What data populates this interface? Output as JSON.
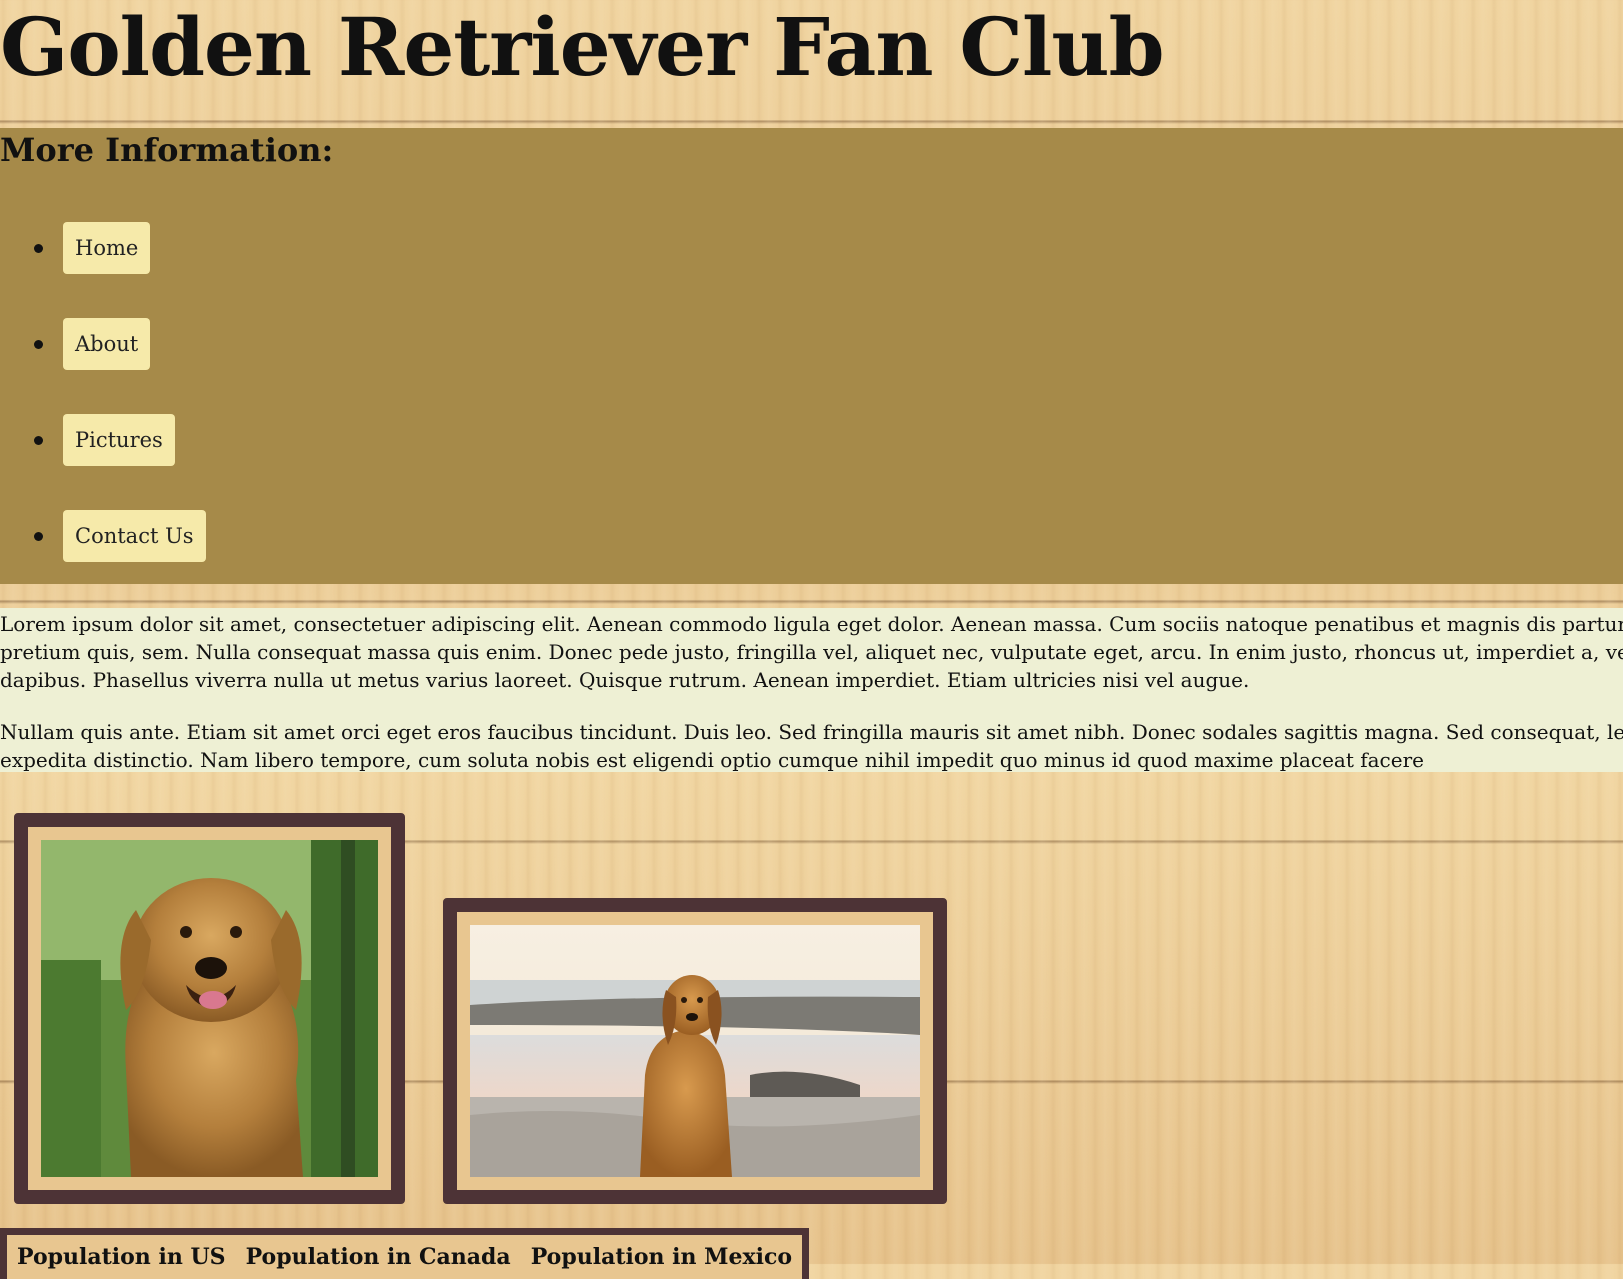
{
  "header": {
    "title": "Golden Retriever Fan Club"
  },
  "nav": {
    "heading": "More Information:",
    "items": [
      {
        "label": "Home"
      },
      {
        "label": "About"
      },
      {
        "label": "Pictures"
      },
      {
        "label": "Contact Us"
      }
    ]
  },
  "intro": {
    "lines": [
      "Lorem ipsum dolor sit amet, consectetuer adipiscing elit. Aenean commodo ligula eget dolor. Aenean massa. Cum sociis natoque penatibus et magnis dis parturi",
      "pretium quis, sem. Nulla consequat massa quis enim. Donec pede justo, fringilla vel, aliquet nec, vulputate eget, arcu. In enim justo, rhoncus ut, imperdiet a, vene",
      "dapibus. Phasellus viverra nulla ut metus varius laoreet. Quisque rutrum. Aenean imperdiet. Etiam ultricies nisi vel augue.",
      "Nullam quis ante. Etiam sit amet orci eget eros faucibus tincidunt. Duis leo. Sed fringilla mauris sit amet nibh. Donec sodales sagittis magna. Sed consequat, leo e",
      "expedita distinctio. Nam libero tempore, cum soluta nobis est eligendi optio cumque nihil impedit quo minus id quod maxime placeat facere"
    ]
  },
  "table": {
    "headers": [
      "Population in US",
      "Population in Canada",
      "Population in Mexico"
    ]
  },
  "colors": {
    "nav_panel": "#a68a49",
    "nav_button": "#f6eaaa",
    "intro_bg": "#eef0d4",
    "frame": "#4d3336",
    "wood": "#efd29e"
  }
}
